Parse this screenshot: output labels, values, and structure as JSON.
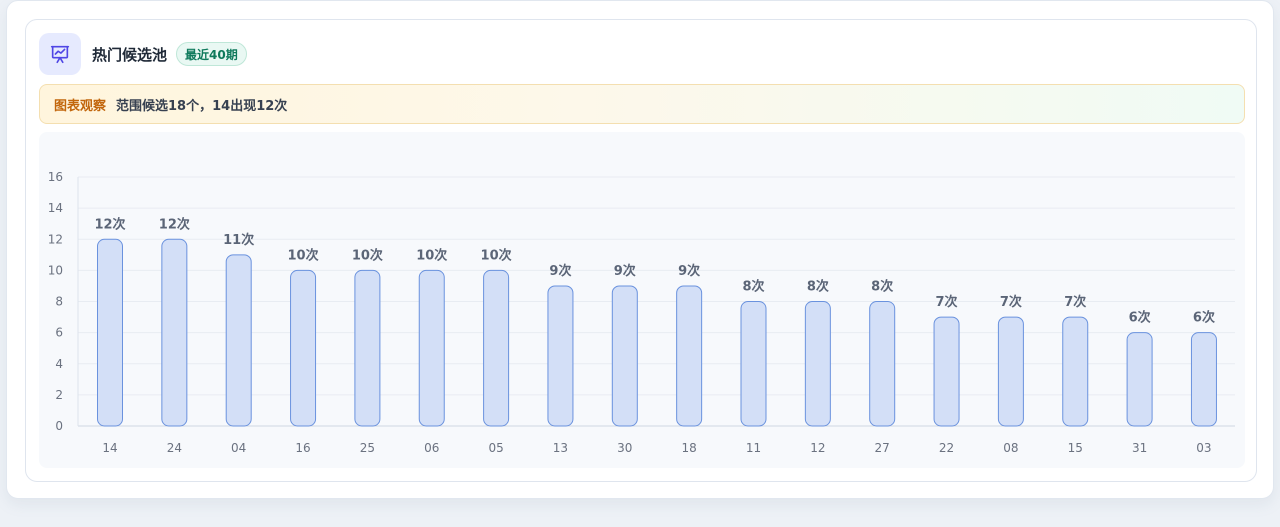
{
  "header": {
    "title": "热门候选池",
    "badge": "最近40期",
    "icon": "presentation-chart-icon"
  },
  "observation": {
    "label": "图表观察",
    "text": "范围候选18个，14出现12次"
  },
  "colors": {
    "bar_fill": "#d3dff7",
    "bar_stroke": "#6a92de",
    "icon": "#4f46e5",
    "badge_text": "#0f7a5c",
    "obs_label": "#c2660c"
  },
  "chart_data": {
    "type": "bar",
    "categories": [
      "14",
      "24",
      "04",
      "16",
      "25",
      "06",
      "05",
      "13",
      "30",
      "18",
      "11",
      "12",
      "27",
      "22",
      "08",
      "15",
      "31",
      "03"
    ],
    "values": [
      12,
      12,
      11,
      10,
      10,
      10,
      10,
      9,
      9,
      9,
      8,
      8,
      8,
      7,
      7,
      7,
      6,
      6
    ],
    "data_labels": [
      "12次",
      "12次",
      "11次",
      "10次",
      "10次",
      "10次",
      "10次",
      "9次",
      "9次",
      "9次",
      "8次",
      "8次",
      "8次",
      "7次",
      "7次",
      "7次",
      "6次",
      "6次"
    ],
    "ylim": [
      0,
      16
    ],
    "yticks": [
      0,
      2,
      4,
      6,
      8,
      10,
      12,
      14,
      16
    ],
    "grid": true
  }
}
